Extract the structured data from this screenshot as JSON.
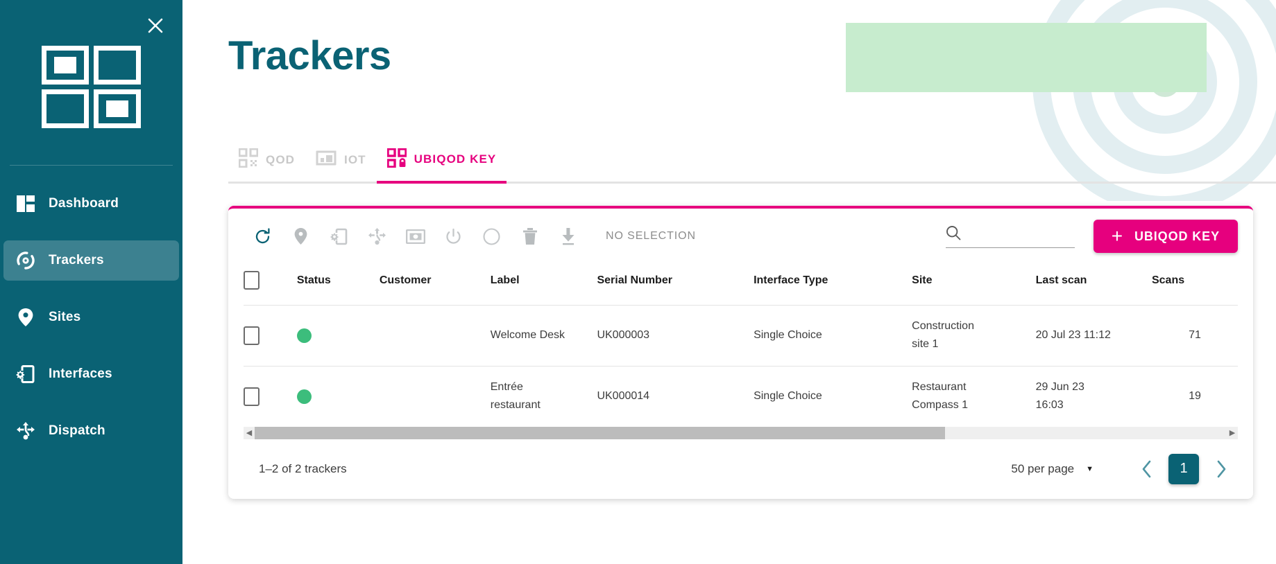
{
  "theme": {
    "sidebar_bg": "#0a6274",
    "accent_pink": "#e6007e",
    "teal": "#0a6274",
    "status_green": "#3cbd7c",
    "deco_green": "#c7ecce"
  },
  "sidebar": {
    "close_label": "✕",
    "logo_name": "ubiqod-logo",
    "items": [
      {
        "label": "Dashboard",
        "icon": "dashboard-icon",
        "active": false
      },
      {
        "label": "Trackers",
        "icon": "tracker-icon",
        "active": true
      },
      {
        "label": "Sites",
        "icon": "location-pin-icon",
        "active": false
      },
      {
        "label": "Interfaces",
        "icon": "interface-gear-icon",
        "active": false
      },
      {
        "label": "Dispatch",
        "icon": "dispatch-icon",
        "active": false
      }
    ]
  },
  "header": {
    "title": "Trackers"
  },
  "tabs": [
    {
      "label": "QOD",
      "icon": "qr-code-icon",
      "active": false
    },
    {
      "label": "IOT",
      "icon": "iot-device-icon",
      "active": false
    },
    {
      "label": "UBIQOD KEY",
      "icon": "key-lock-qr-icon",
      "active": true
    }
  ],
  "toolbar": {
    "icons": [
      "refresh-icon",
      "location-pin-icon",
      "interface-gear-icon",
      "dispatch-icon",
      "cash-icon",
      "power-icon",
      "circle-icon",
      "trash-icon",
      "download-icon"
    ],
    "selection_text": "NO SELECTION",
    "search_placeholder": "",
    "search_value": "",
    "add_button_label": "UBIQOD KEY",
    "add_button_plus": "+"
  },
  "table": {
    "columns": [
      "",
      "Status",
      "Customer",
      "Label",
      "Serial Number",
      "Interface Type",
      "Site",
      "Last scan",
      "Scans"
    ],
    "rows": [
      {
        "checked": false,
        "status": "online",
        "customer": "",
        "label": "Welcome Desk",
        "serial": "UK000003",
        "interface_type": "Single Choice",
        "site": "Construction site 1",
        "last_scan": "20 Jul 23 11:12",
        "scans": "71"
      },
      {
        "checked": false,
        "status": "online",
        "customer": "",
        "label": "Entrée restaurant",
        "serial": "UK000014",
        "interface_type": "Single Choice",
        "site": "Restaurant Compass 1",
        "last_scan": "29 Jun 23 16:03",
        "scans": "19"
      }
    ]
  },
  "footer": {
    "count_text": "1–2 of 2 trackers",
    "per_page_label": "50 per page",
    "per_page_caret": "▼",
    "prev_label": "‹",
    "next_label": "›",
    "current_page": "1"
  }
}
